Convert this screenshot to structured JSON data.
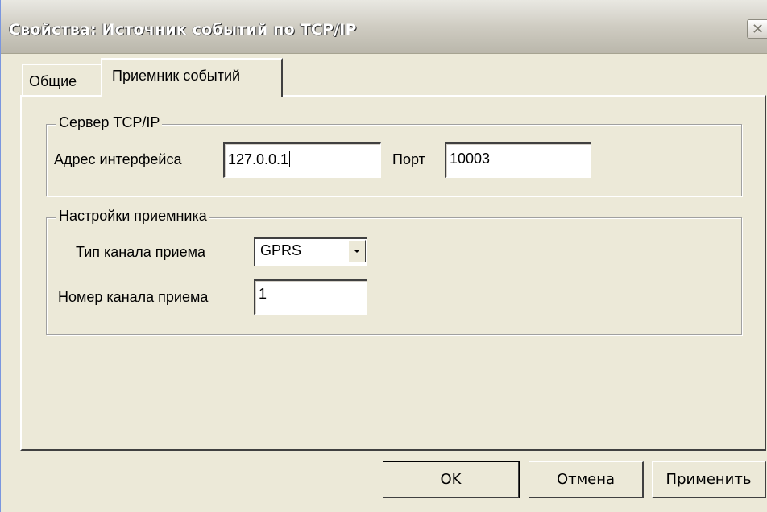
{
  "window": {
    "title": "Свойства: Источник событий по TCP/IP",
    "close_glyph": "✕"
  },
  "tabs": [
    {
      "label": "Общие",
      "selected": false
    },
    {
      "label": "Приемник событий",
      "selected": true
    }
  ],
  "server_group": {
    "legend": "Сервер TCP/IP",
    "address_label": "Адрес интерфейса",
    "address_value": "127.0.0.1",
    "port_label": "Порт",
    "port_value": "10003"
  },
  "receiver_group": {
    "legend": "Настройки приемника",
    "channel_type_label": "Тип канала приема",
    "channel_type_value": "GPRS",
    "channel_number_label": "Номер канала приема",
    "channel_number_value": "1"
  },
  "buttons": {
    "ok": "OK",
    "cancel": "Отмена",
    "apply_pre": "При",
    "apply_mnemonic": "м",
    "apply_post": "енить"
  }
}
